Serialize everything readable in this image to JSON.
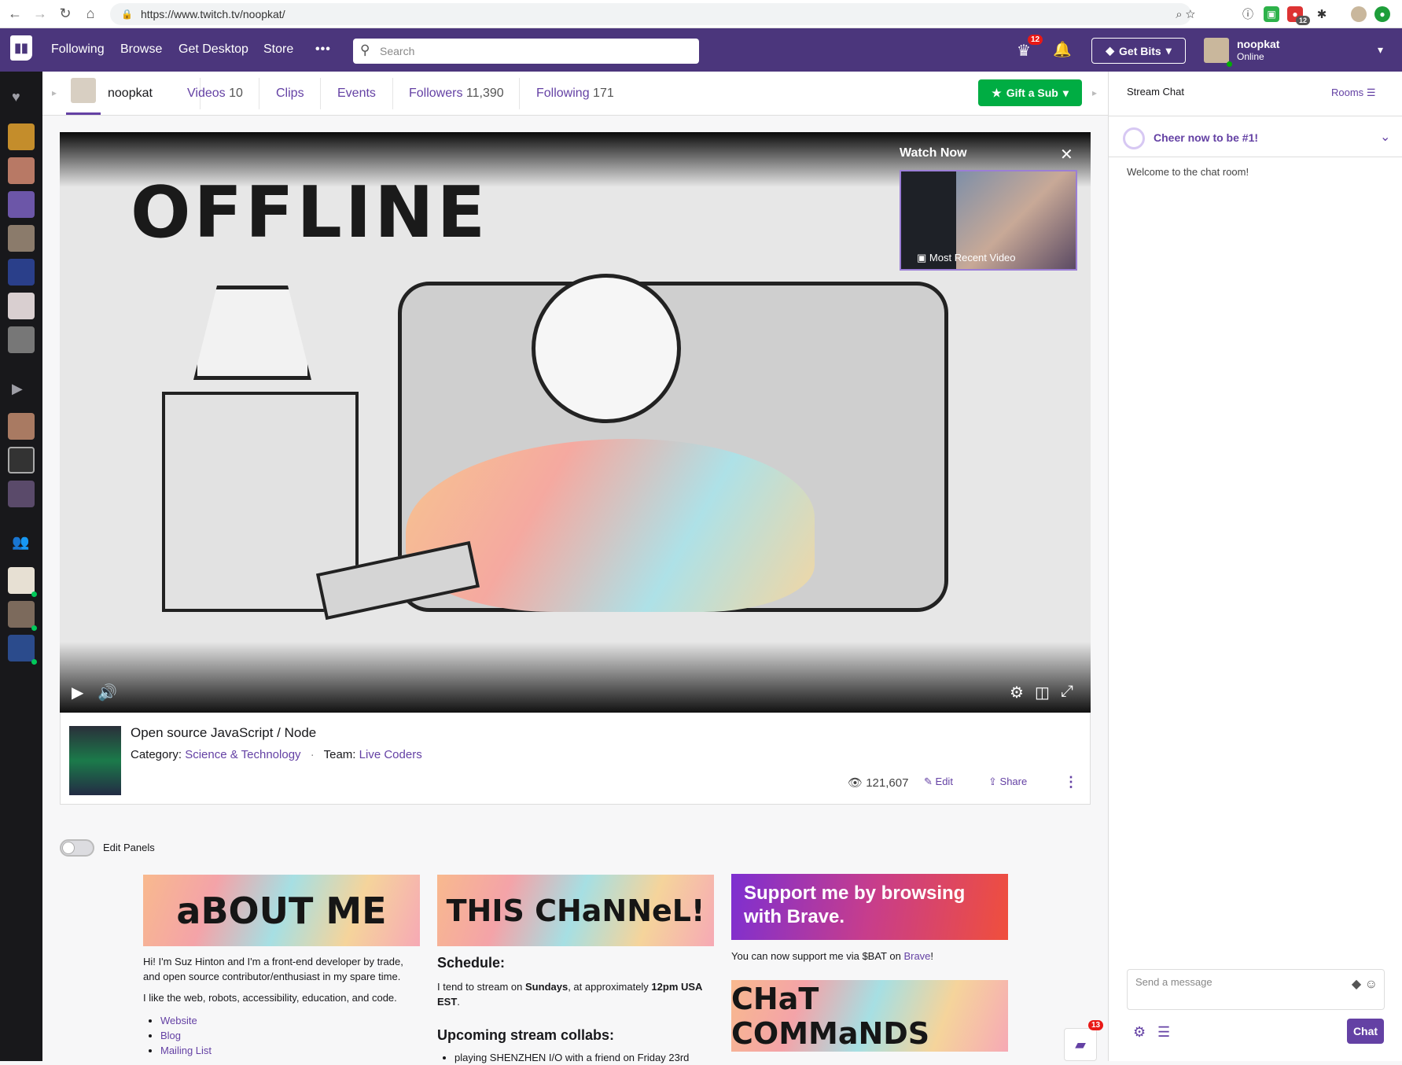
{
  "browser": {
    "url": "https://www.twitch.tv/noopkat/",
    "ext_badge": "12"
  },
  "topnav": {
    "links": [
      "Following",
      "Browse",
      "Get Desktop",
      "Store"
    ],
    "more": "•••",
    "search_placeholder": "Search",
    "crown_badge": "12",
    "get_bits": "Get Bits",
    "user": {
      "name": "noopkat",
      "status": "Online"
    }
  },
  "channel": {
    "name": "noopkat",
    "tabs": [
      {
        "label": "Videos",
        "count": "10"
      },
      {
        "label": "Clips",
        "count": ""
      },
      {
        "label": "Events",
        "count": ""
      },
      {
        "label": "Followers",
        "count": "11,390"
      },
      {
        "label": "Following",
        "count": "171"
      }
    ],
    "gift_sub": "Gift a Sub"
  },
  "player": {
    "offline_art_text": "OFFLINE",
    "watch_now": "Watch Now",
    "most_recent": "Most Recent Video"
  },
  "stream": {
    "title": "Open source JavaScript / Node",
    "category_label": "Category:",
    "category": "Science & Technology",
    "team_label": "Team:",
    "team": "Live Coders",
    "viewers": "121,607",
    "edit": "Edit",
    "share": "Share"
  },
  "panels": {
    "edit_label": "Edit Panels",
    "about_img": "aBOUT ME",
    "about_p1": "Hi! I'm Suz Hinton and I'm a front-end developer by trade, and open source contributor/enthusiast in my spare time.",
    "about_p2": "I like the web, robots, accessibility, education, and code.",
    "about_links": [
      "Website",
      "Blog",
      "Mailing List"
    ],
    "channel_img": "THIS CHaNNeL!",
    "schedule_head": "Schedule:",
    "schedule_pre": "I tend to stream on ",
    "schedule_day": "Sundays",
    "schedule_mid": ", at approximately ",
    "schedule_time": "12pm USA EST",
    "schedule_end": ".",
    "collab_head": "Upcoming stream collabs:",
    "collab_item": "playing SHENZHEN I/O with a friend on Friday 23rd",
    "brave_text": "Support me by browsing with Brave.",
    "brave_pre": "You can now support me via $BAT on ",
    "brave_link": "Brave",
    "brave_end": "!",
    "commands_img": "CHaT COMMaNDS",
    "whispers_badge": "13"
  },
  "chat": {
    "title": "Stream Chat",
    "rooms": "Rooms",
    "cheer": "Cheer now to be #1!",
    "welcome": "Welcome to the chat room!",
    "placeholder": "Send a message",
    "send": "Chat"
  }
}
